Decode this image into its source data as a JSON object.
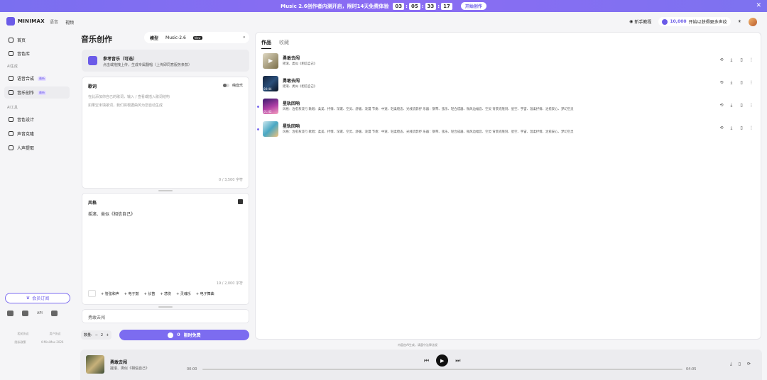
{
  "banner": {
    "text": "Music 2.6创作者内测开启，限时14天免费体验",
    "countdown": [
      "03",
      "05",
      "33",
      "17"
    ],
    "cta": "开始创作"
  },
  "topnav": {
    "brand": "MINIMAX",
    "brand_sub": "语音",
    "video_tab": "视频",
    "tutorial": "新手教程",
    "credits": "10,000",
    "upgrade": "开始以获得更多声纹"
  },
  "sidebar": {
    "items": [
      {
        "label": "首页",
        "icon": "home-icon"
      },
      {
        "label": "音色库",
        "icon": "library-icon"
      }
    ],
    "section_ai": "AI生成",
    "ai_items": [
      {
        "label": "语音合成",
        "badge": "最新",
        "icon": "speech-icon"
      },
      {
        "label": "音乐创作",
        "badge": "最新",
        "icon": "music-icon"
      }
    ],
    "section_tools": "AI工具",
    "tool_items": [
      {
        "label": "音色设计",
        "icon": "voice-design-icon"
      },
      {
        "label": "声音克隆",
        "icon": "clone-icon"
      },
      {
        "label": "人声提取",
        "icon": "extract-icon"
      }
    ],
    "member_btn": "会员订阅",
    "social_api": "API",
    "footer": [
      "相关协议",
      "用户协议",
      "隐私政策",
      "©MiniMax 2026"
    ]
  },
  "main": {
    "title": "音乐创作",
    "model_label": "模型",
    "model_value": "Music-2.6",
    "model_badge": "New",
    "ref": {
      "title": "参考音乐（可选）",
      "subtitle": "点击或拖拽上传，生成专属翻唱（上传即同意服务条款）"
    },
    "lyrics": {
      "title": "歌词",
      "toggle": "纯音乐",
      "placeholder1": "在此添加你自己的歌词，输入 / 查看或插入歌词结构",
      "placeholder2": "如果空未填歌词，我们将根据曲风为您自动生成",
      "count": "0 / 3,500 字符"
    },
    "style": {
      "title": "风格",
      "value": "摇滚、类似《相信自己》",
      "count": "19 / 2,000 字符",
      "tags": [
        "+ 管弦和声",
        "+ 电子鼓",
        "+ 长笛",
        "+ 悲伤",
        "+ 灵魂乐",
        "+ 电子舞曲"
      ]
    },
    "song_title": "勇敢去闯",
    "qty_label": "数量:",
    "qty_value": "2",
    "create_count": "0",
    "create_label": "限时免费"
  },
  "works": {
    "tabs": [
      "作品",
      "收藏"
    ],
    "songs": [
      {
        "title": "勇敢去闯",
        "desc": "摇滚、类似《相信自己》",
        "duration": "",
        "new": false,
        "gradient": "linear-gradient(135deg,#e0d9c3,#7a6e48)"
      },
      {
        "title": "勇敢去闯",
        "desc": "摇滚、类似《相信自己》",
        "duration": "04:44",
        "new": false,
        "gradient": "linear-gradient(135deg,#16233c,#2a4f7a 50%,#0b1322)"
      },
      {
        "title": "星轨回响",
        "desc": "风格：治愈系流行 歌唱：柔美、抒情、深邃、空灵、舒缓、浪漫 节奏：中速、轻柔稳态、光线流影抒 乐器：钢琴、弦乐、轻合成器、微风边幅音、空灵 背景克隆刻、星空、宇宙、温柔抒情、治愈安心、梦幻空灵",
        "duration": "01:42",
        "new": true,
        "gradient": "linear-gradient(160deg,#3a1a6d,#b13fa6 55%,#f6a3c0)"
      },
      {
        "title": "星轨回响",
        "desc": "风格：治愈系流行 歌唱：柔美、抒情、深邃、空灵、舒缓、浪漫 节奏：中速、轻柔稳态、光线流影抒 乐器：钢琴、弦乐、轻合成器、微风边幅音、空灵 背景克隆刻、星空、宇宙、温柔抒情、治愈安心、梦幻空灵",
        "duration": "",
        "new": true,
        "gradient": "linear-gradient(135deg,#cfe8ef,#49a7c3 50%,#f2c27a)"
      }
    ],
    "hint": "内容由AI生成，请遵守法律法规"
  },
  "player": {
    "title": "勇敢去闯",
    "desc": "摇滚、类似《相信自己》",
    "time_current": "00:00",
    "time_total": "04:05"
  }
}
